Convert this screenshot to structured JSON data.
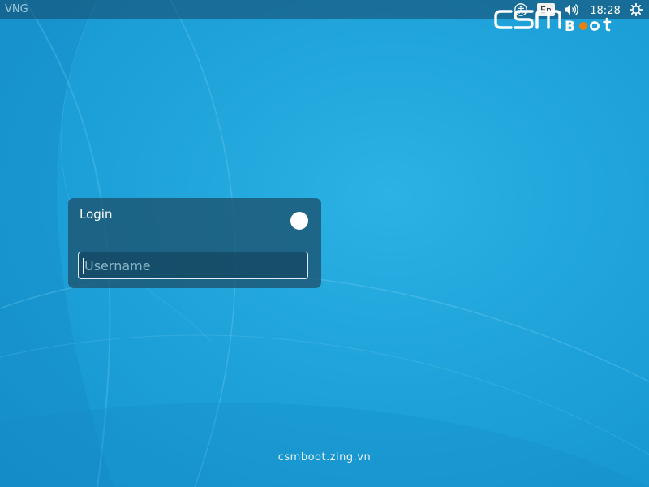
{
  "top_panel": {
    "host_label": "VNG",
    "language": "En",
    "clock": "18:28"
  },
  "logo": {
    "text_a": "CSM",
    "text_b": "Boot",
    "accent_color": "#e8820c"
  },
  "login": {
    "title": "Login",
    "username_placeholder": "Username",
    "username_value": ""
  },
  "footer": {
    "url": "csmboot.zing.vn"
  },
  "colors": {
    "background": "#1fa3da",
    "panel": "#1c526e",
    "top_panel": "#14465f"
  },
  "icons": {
    "accessibility": "accessibility-icon",
    "sound": "sound-icon",
    "power": "power-icon",
    "session": "session-toggle-icon"
  }
}
